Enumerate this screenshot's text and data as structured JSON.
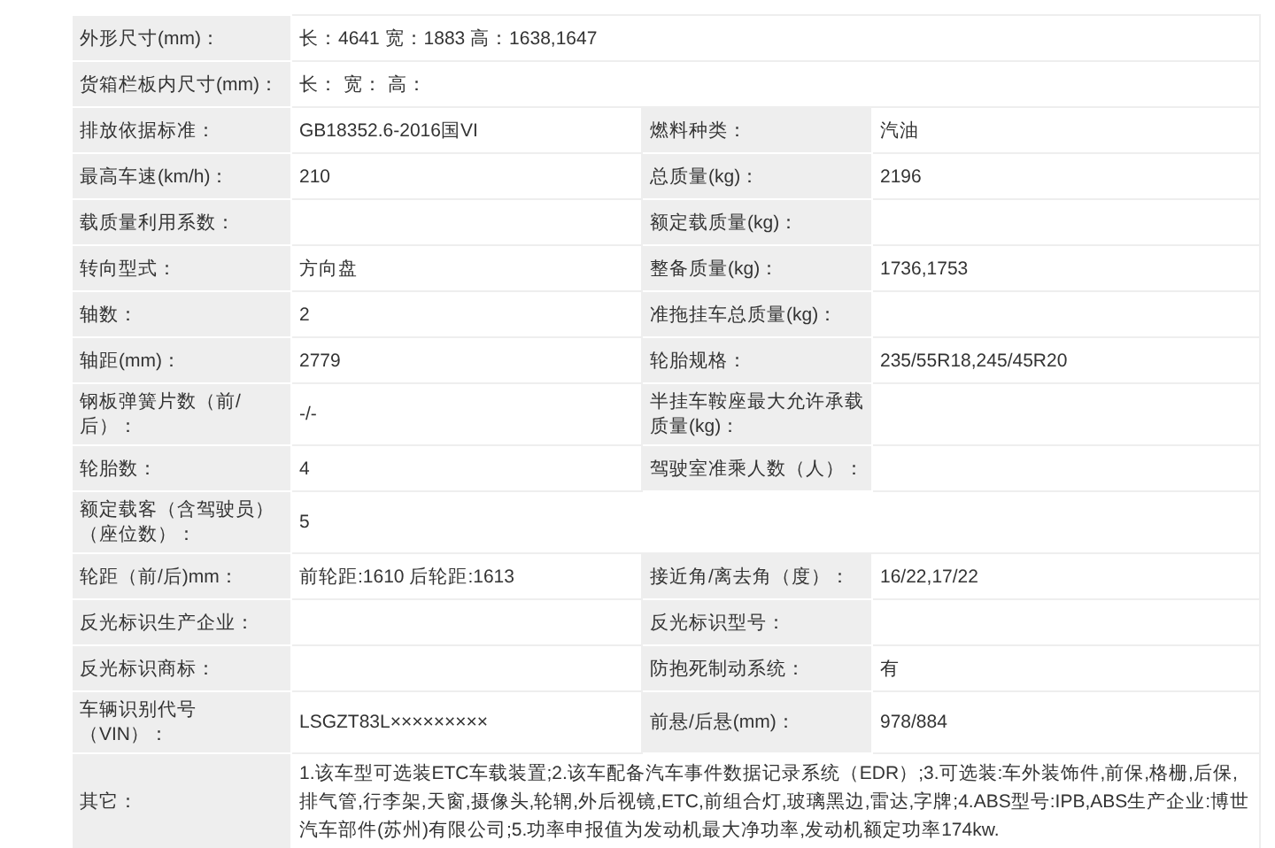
{
  "rows": [
    {
      "cells": [
        {
          "label": "外形尺寸(mm)：",
          "value": "长：4641 宽：1883 高：1638,1647"
        }
      ]
    },
    {
      "cells": [
        {
          "label": "货箱栏板内尺寸(mm)：",
          "value": "长： 宽： 高："
        }
      ]
    },
    {
      "cells": [
        {
          "label": "排放依据标准：",
          "value": "GB18352.6-2016国VI"
        },
        {
          "label": "燃料种类：",
          "value": "汽油"
        }
      ]
    },
    {
      "cells": [
        {
          "label": "最高车速(km/h)：",
          "value": "210"
        },
        {
          "label": "总质量(kg)：",
          "value": "2196"
        }
      ]
    },
    {
      "cells": [
        {
          "label": "载质量利用系数："
        },
        {
          "label": "额定载质量(kg)："
        }
      ]
    },
    {
      "cells": [
        {
          "label": "转向型式：",
          "value": "方向盘"
        },
        {
          "label": "整备质量(kg)：",
          "value": "1736,1753"
        }
      ]
    },
    {
      "cells": [
        {
          "label": "轴数：",
          "value": "2"
        },
        {
          "label": "准拖挂车总质量(kg)："
        }
      ]
    },
    {
      "cells": [
        {
          "label": "轴距(mm)：",
          "value": "2779"
        },
        {
          "label": "轮胎规格：",
          "value": "235/55R18,245/45R20"
        }
      ]
    },
    {
      "cells": [
        {
          "label": "钢板弹簧片数（前/后）：",
          "value": "-/-"
        },
        {
          "label": "半挂车鞍座最大允许承载质量(kg)："
        }
      ]
    },
    {
      "cells": [
        {
          "label": "轮胎数：",
          "value": "4"
        },
        {
          "label": "驾驶室准乘人数（人）："
        }
      ]
    },
    {
      "cells": [
        {
          "label": "额定载客（含驾驶员）（座位数）：",
          "value": "5"
        }
      ]
    },
    {
      "cells": [
        {
          "label": "轮距（前/后)mm：",
          "value": "前轮距:1610 后轮距:1613"
        },
        {
          "label": "接近角/离去角（度）：",
          "value": "16/22,17/22"
        }
      ]
    },
    {
      "cells": [
        {
          "label": "反光标识生产企业："
        },
        {
          "label": "反光标识型号："
        }
      ]
    },
    {
      "cells": [
        {
          "label": "反光标识商标："
        },
        {
          "label": "防抱死制动系统：",
          "value": "有"
        }
      ]
    },
    {
      "cells": [
        {
          "label": "车辆识别代号（VIN）：",
          "value": "LSGZT83L×××××××××"
        },
        {
          "label": "前悬/后悬(mm)：",
          "value": "978/884"
        }
      ]
    },
    {
      "cells": [
        {
          "label": "其它：",
          "value": "1.该车型可选装ETC车载装置;2.该车配备汽车事件数据记录系统（EDR）;3.可选装:车外装饰件,前保,格栅,后保,排气管,行李架,天窗,摄像头,轮辋,外后视镜,ETC,前组合灯,玻璃黑边,雷达,字牌;4.ABS型号:IPB,ABS生产企业:博世汽车部件(苏州)有限公司;5.功率申报值为发动机最大净功率,发动机额定功率174kw."
        }
      ]
    }
  ]
}
